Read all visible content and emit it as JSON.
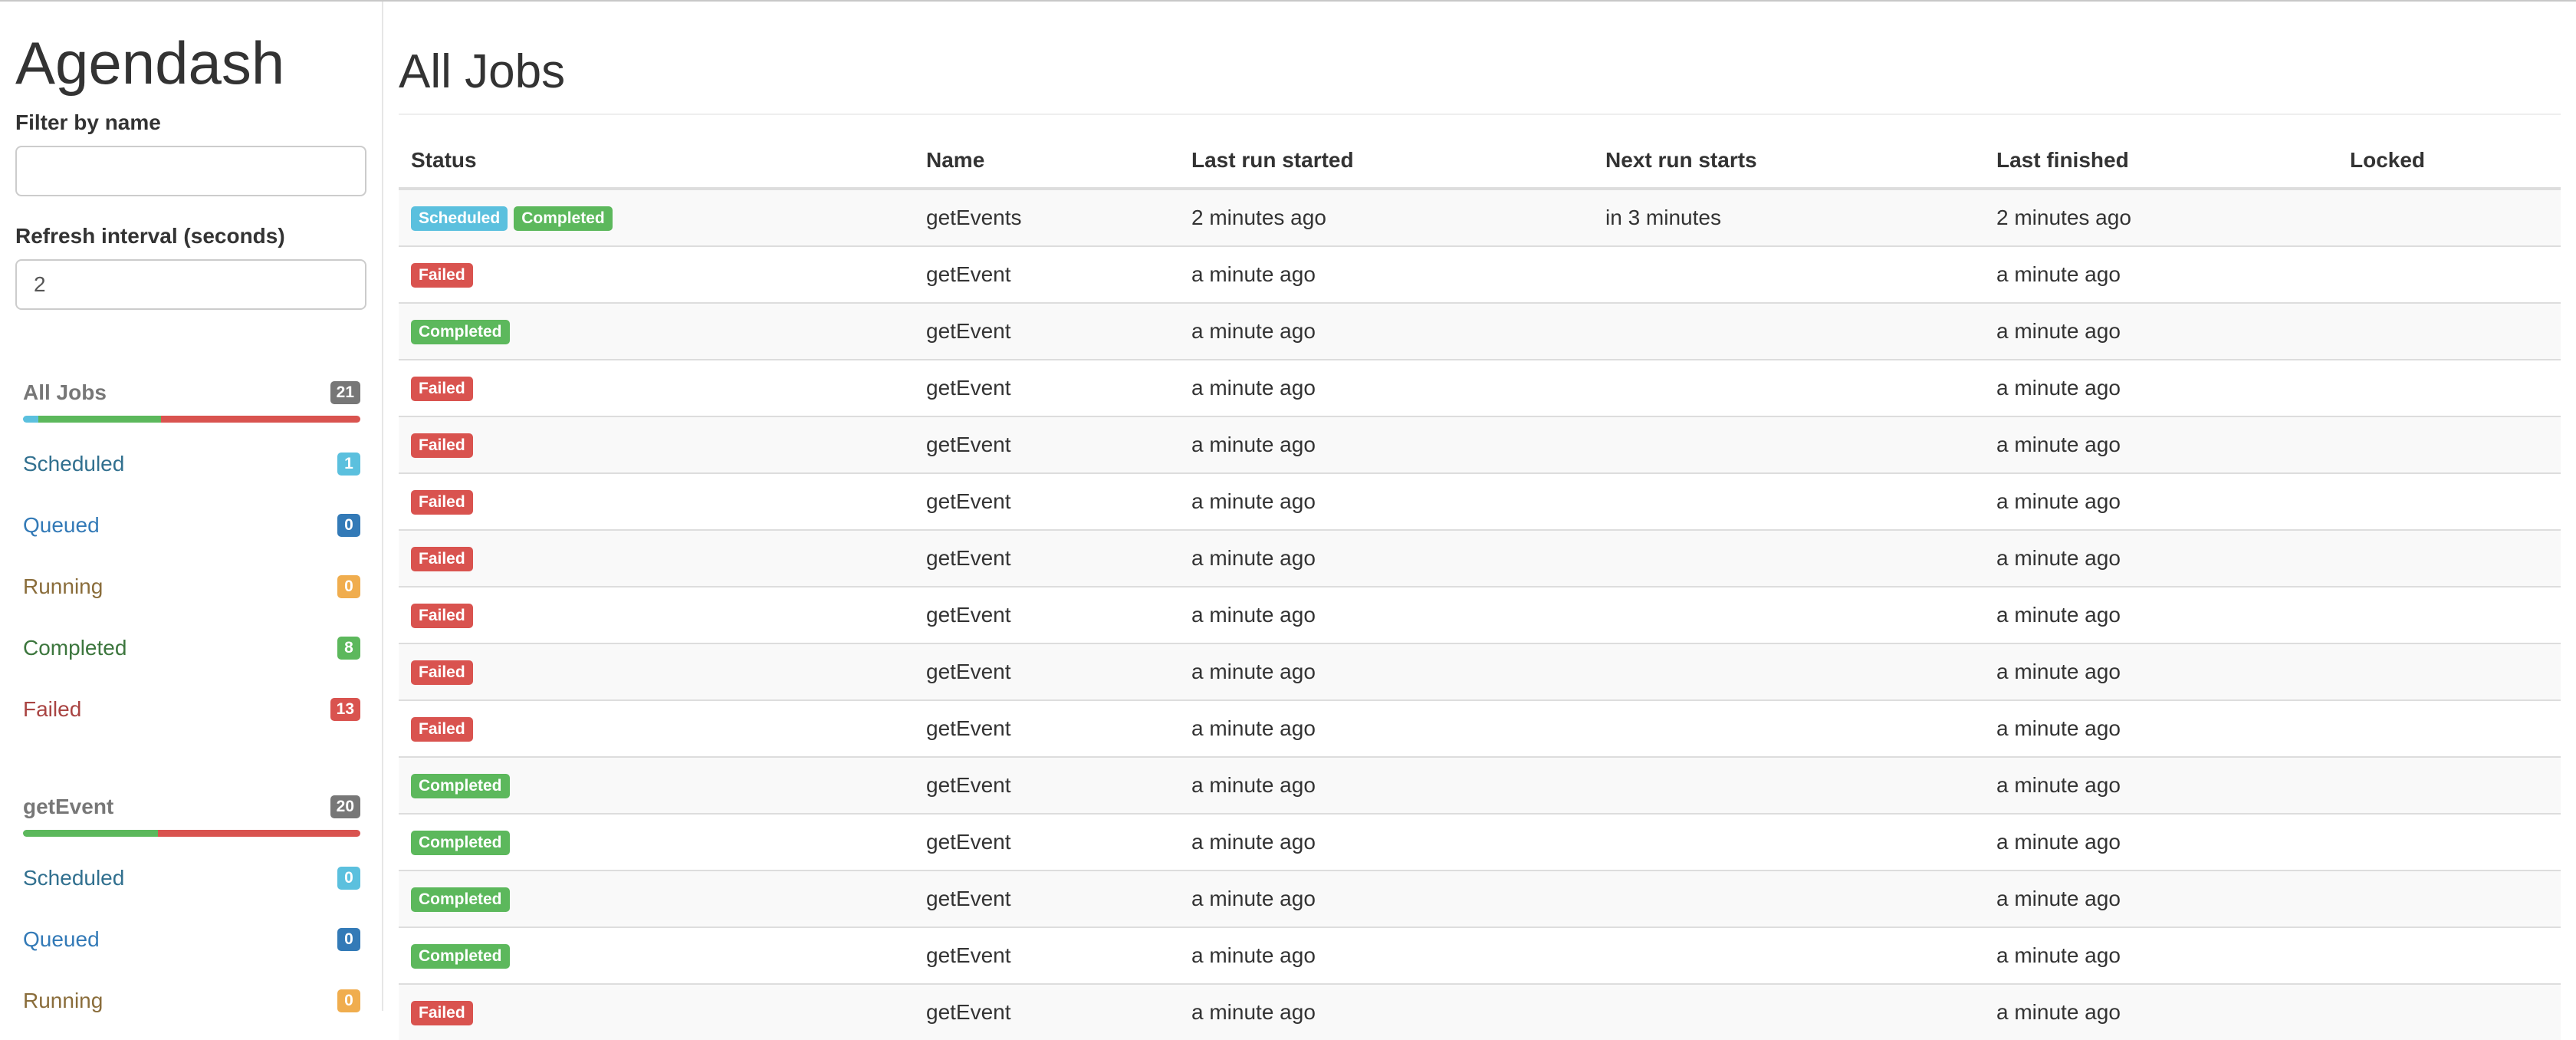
{
  "app": {
    "brand": "Agendash"
  },
  "filters": {
    "name_label": "Filter by name",
    "name_value": "",
    "refresh_label": "Refresh interval (seconds)",
    "refresh_value": "2"
  },
  "colors": {
    "scheduled": "#5bc0de",
    "queued": "#337ab7",
    "running": "#f0ad4e",
    "completed": "#5cb85c",
    "failed": "#d9534f",
    "total": "#777777"
  },
  "groups": [
    {
      "title": "All Jobs",
      "count": "21",
      "bar": {
        "scheduled": 1,
        "completed": 8,
        "failed": 13
      },
      "statuses": [
        {
          "key": "scheduled",
          "label": "Scheduled",
          "count": "1"
        },
        {
          "key": "queued",
          "label": "Queued",
          "count": "0"
        },
        {
          "key": "running",
          "label": "Running",
          "count": "0"
        },
        {
          "key": "completed",
          "label": "Completed",
          "count": "8"
        },
        {
          "key": "failed",
          "label": "Failed",
          "count": "13"
        }
      ]
    },
    {
      "title": "getEvent",
      "count": "20",
      "bar": {
        "scheduled": 0,
        "completed": 8,
        "failed": 12
      },
      "statuses": [
        {
          "key": "scheduled",
          "label": "Scheduled",
          "count": "0"
        },
        {
          "key": "queued",
          "label": "Queued",
          "count": "0"
        },
        {
          "key": "running",
          "label": "Running",
          "count": "0"
        }
      ]
    }
  ],
  "main": {
    "title": "All Jobs",
    "columns": [
      "Status",
      "Name",
      "Last run started",
      "Next run starts",
      "Last finished",
      "Locked"
    ],
    "rows": [
      {
        "statuses": [
          "Scheduled",
          "Completed"
        ],
        "name": "getEvents",
        "last_run": "2 minutes ago",
        "next_run": "in 3 minutes",
        "last_finished": "2 minutes ago",
        "locked": ""
      },
      {
        "statuses": [
          "Failed"
        ],
        "name": "getEvent",
        "last_run": "a minute ago",
        "next_run": "",
        "last_finished": "a minute ago",
        "locked": ""
      },
      {
        "statuses": [
          "Completed"
        ],
        "name": "getEvent",
        "last_run": "a minute ago",
        "next_run": "",
        "last_finished": "a minute ago",
        "locked": ""
      },
      {
        "statuses": [
          "Failed"
        ],
        "name": "getEvent",
        "last_run": "a minute ago",
        "next_run": "",
        "last_finished": "a minute ago",
        "locked": ""
      },
      {
        "statuses": [
          "Failed"
        ],
        "name": "getEvent",
        "last_run": "a minute ago",
        "next_run": "",
        "last_finished": "a minute ago",
        "locked": ""
      },
      {
        "statuses": [
          "Failed"
        ],
        "name": "getEvent",
        "last_run": "a minute ago",
        "next_run": "",
        "last_finished": "a minute ago",
        "locked": ""
      },
      {
        "statuses": [
          "Failed"
        ],
        "name": "getEvent",
        "last_run": "a minute ago",
        "next_run": "",
        "last_finished": "a minute ago",
        "locked": ""
      },
      {
        "statuses": [
          "Failed"
        ],
        "name": "getEvent",
        "last_run": "a minute ago",
        "next_run": "",
        "last_finished": "a minute ago",
        "locked": ""
      },
      {
        "statuses": [
          "Failed"
        ],
        "name": "getEvent",
        "last_run": "a minute ago",
        "next_run": "",
        "last_finished": "a minute ago",
        "locked": ""
      },
      {
        "statuses": [
          "Failed"
        ],
        "name": "getEvent",
        "last_run": "a minute ago",
        "next_run": "",
        "last_finished": "a minute ago",
        "locked": ""
      },
      {
        "statuses": [
          "Completed"
        ],
        "name": "getEvent",
        "last_run": "a minute ago",
        "next_run": "",
        "last_finished": "a minute ago",
        "locked": ""
      },
      {
        "statuses": [
          "Completed"
        ],
        "name": "getEvent",
        "last_run": "a minute ago",
        "next_run": "",
        "last_finished": "a minute ago",
        "locked": ""
      },
      {
        "statuses": [
          "Completed"
        ],
        "name": "getEvent",
        "last_run": "a minute ago",
        "next_run": "",
        "last_finished": "a minute ago",
        "locked": ""
      },
      {
        "statuses": [
          "Completed"
        ],
        "name": "getEvent",
        "last_run": "a minute ago",
        "next_run": "",
        "last_finished": "a minute ago",
        "locked": ""
      },
      {
        "statuses": [
          "Failed"
        ],
        "name": "getEvent",
        "last_run": "a minute ago",
        "next_run": "",
        "last_finished": "a minute ago",
        "locked": ""
      }
    ]
  }
}
